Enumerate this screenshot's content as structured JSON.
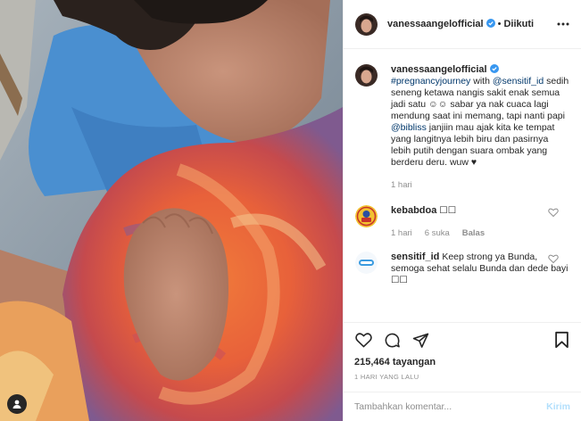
{
  "post": {
    "username": "vanessaangelofficial",
    "separator": "•",
    "follow_state": "Diikuti"
  },
  "caption": {
    "username": "vanessaangelofficial",
    "hashtag": "#pregnancyjourney",
    "with_word": " with ",
    "mention1": "@sensitif_id",
    "text1": " sedih seneng ketawa nangis sakit enak semua jadi satu ☺☺ sabar ya nak cuaca lagi mendung saat ini memang, tapi nanti papi ",
    "mention2": "@bibliss",
    "text2": " janjiin mau ajak kita ke tempat yang langitnya lebih biru dan pasirnya lebih putih dengan suara ombak yang berderu deru. wuw ♥",
    "time": "1 hari"
  },
  "comments": [
    {
      "username": "kebabdoa",
      "text": " ☐☐",
      "time": "1 hari",
      "likes": "6 suka",
      "reply": "Balas",
      "avatar_icon": "kebab-logo-icon"
    },
    {
      "username": "sensitif_id",
      "text": " Keep strong ya Bunda, semoga sehat selalu Bunda dan dede bayi ☐☐",
      "avatar_icon": "sensitif-logo-icon"
    }
  ],
  "stats": {
    "views": "215,464",
    "views_label": " tayangan",
    "date": "1 HARI YANG LALU"
  },
  "composer": {
    "placeholder": "Tambahkan komentar...",
    "post_label": "Kirim"
  },
  "colors": {
    "link": "#00376b",
    "verified": "#3897f0",
    "post_button": "#b2dffc"
  }
}
